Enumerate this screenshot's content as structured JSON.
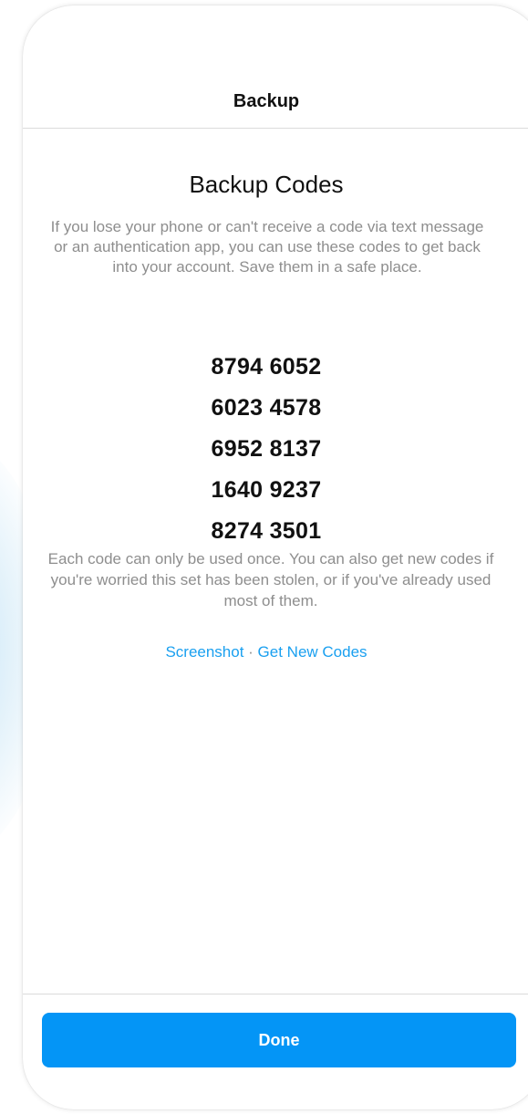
{
  "nav": {
    "title": "Backup"
  },
  "main": {
    "heading": "Backup Codes",
    "description": "If you lose your phone or can't receive a code via text message or an authentication app, you can use these codes to get back into your account. Save them in a safe place.",
    "codes": [
      "8794 6052",
      "6023 4578",
      "6952 8137",
      "1640 9237",
      "8274 3501"
    ],
    "note": "Each code can only be used once. You can also get new codes if you're worried this set has been stolen, or if you've already used most of them.",
    "links": {
      "screenshot": "Screenshot",
      "separator": " · ",
      "get_new_codes": "Get New Codes"
    }
  },
  "footer": {
    "done_label": "Done"
  },
  "colors": {
    "accent": "#0495f6",
    "link": "#1aa0f0",
    "muted_text": "#8e8e8e",
    "primary_text": "#111111",
    "divider": "#dbdbdb"
  }
}
